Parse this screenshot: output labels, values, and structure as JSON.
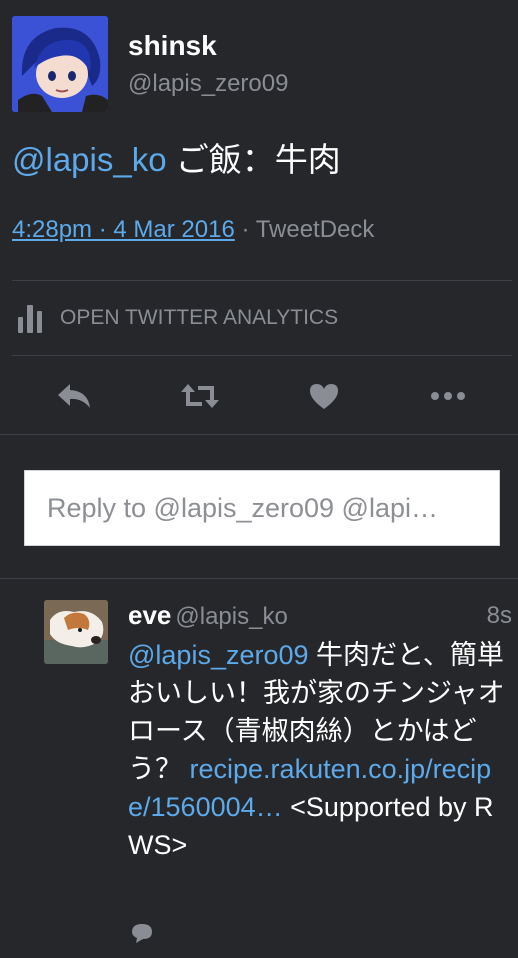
{
  "main_tweet": {
    "author_name": "shinsk",
    "author_handle": "@lapis_zero09",
    "text_mention": "@lapis_ko",
    "text_body": " ご飯：牛肉",
    "timestamp": "4:28pm · 4 Mar 2016",
    "via": " · TweetDeck"
  },
  "analytics": {
    "label": "OPEN TWITTER ANALYTICS"
  },
  "actions": [
    "reply-icon",
    "retweet-icon",
    "like-icon",
    "more-icon"
  ],
  "reply_box": {
    "placeholder": "Reply to @lapis_zero09 @lapi…"
  },
  "reply_tweet": {
    "author_name": "eve",
    "author_handle": "@lapis_ko",
    "time_ago": "8s",
    "text_mention": "@lapis_zero09",
    "text_body": " 牛肉だと、簡単おいしい！我が家のチンジャオロース（青椒肉絲）とかはどう？",
    "link": "recipe.rakuten.co.jp/recipe/1560004…",
    "text_tail": " <Supported by RWS>"
  },
  "colors": {
    "background": "#25272b",
    "link": "#5da9e9",
    "muted": "#8a8d93"
  }
}
